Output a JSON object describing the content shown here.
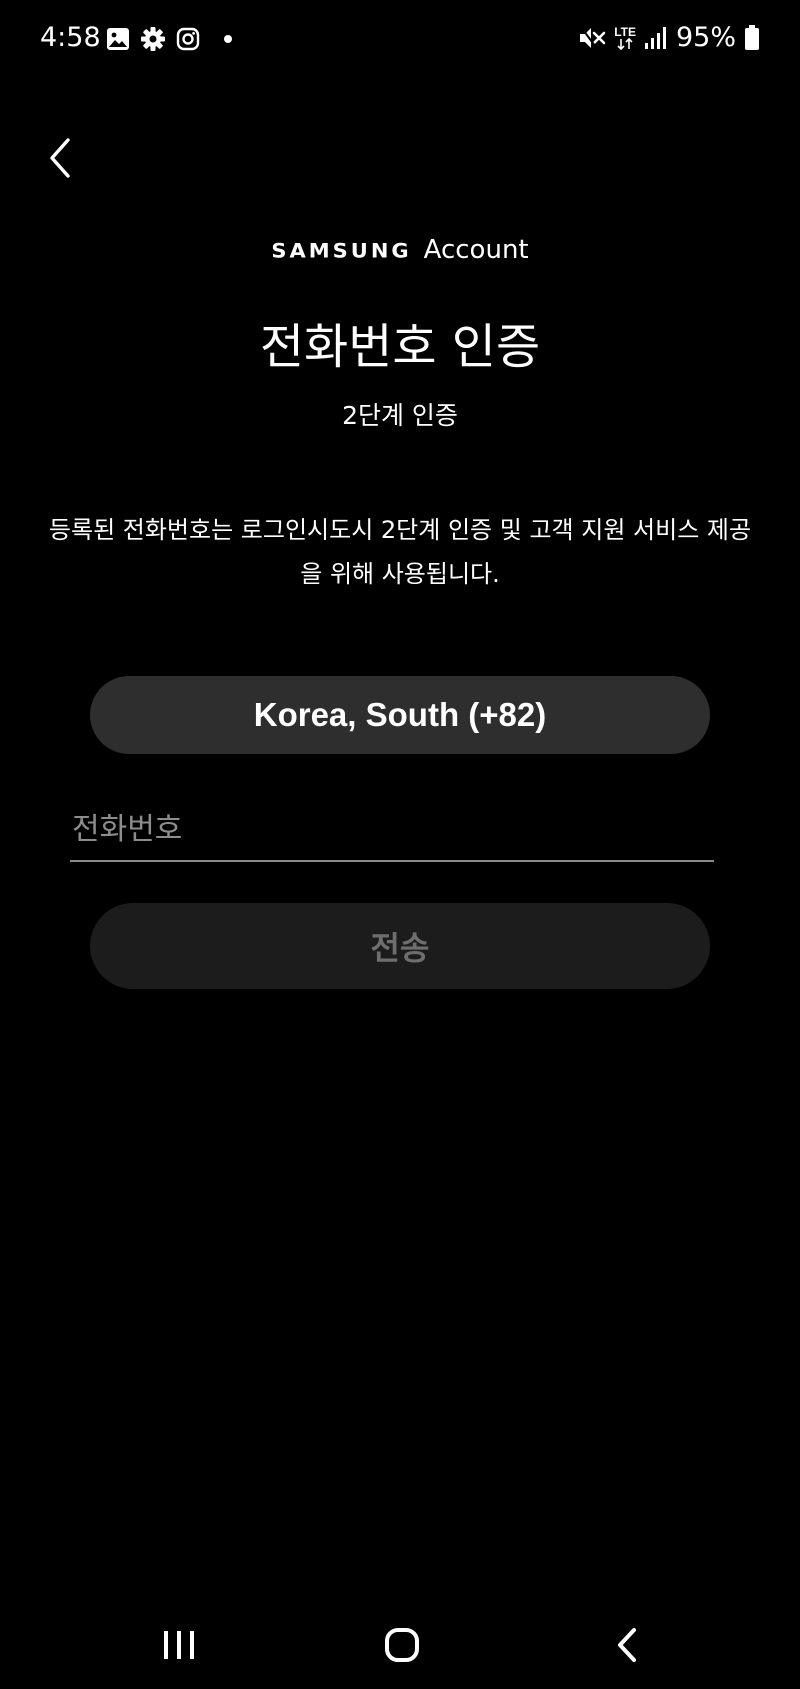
{
  "status_bar": {
    "time": "4:58",
    "left_icons": [
      "gallery-icon",
      "settings-gear-icon",
      "instagram-icon",
      "notification-dot-icon"
    ],
    "right_icons": [
      "mute-icon",
      "lte-icon",
      "signal-icon",
      "battery-icon"
    ],
    "network_label": "LTE",
    "battery_percent": "95%",
    "battery_level": 0.95
  },
  "header": {
    "brand_samsung": "SAMSUNG",
    "brand_account": "Account",
    "title": "전화번호 인증",
    "subtitle": "2단계 인증"
  },
  "description": "등록된 전화번호는 로그인시도시 2단계 인증 및 고객 지원 서비스 제공을 위해 사용됩니다.",
  "country_selector": {
    "label": "Korea, South (+82)"
  },
  "phone_input": {
    "value": "",
    "placeholder": "전화번호"
  },
  "send_button": {
    "label": "전송",
    "enabled": false
  },
  "navigation_bar": {
    "buttons": [
      "recents-icon",
      "home-icon",
      "back-icon"
    ]
  },
  "colors": {
    "background": "#000000",
    "text": "#ffffff",
    "country_button_bg": "#2e2e2e",
    "send_button_bg": "#1c1c1c",
    "send_button_text": "#6e6e6e",
    "placeholder_text": "#8d8d8d",
    "input_underline": "#8a8a8a"
  }
}
